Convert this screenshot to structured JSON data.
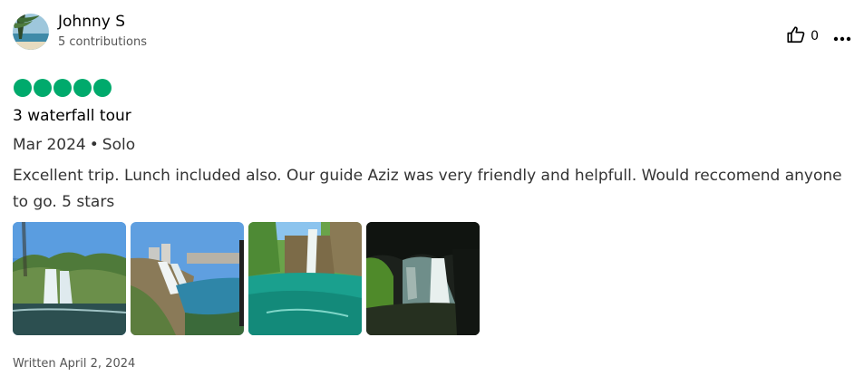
{
  "review": {
    "user": {
      "name": "Johnny S",
      "contributions": "5 contributions"
    },
    "helpful_count": "0",
    "rating": 5,
    "rating_color": "#00AA6C",
    "title": "3 waterfall tour",
    "date": "Mar 2024",
    "trip_type": "Solo",
    "separator": "•",
    "text": "Excellent trip. Lunch included also. Our guide Aziz was very friendly and helpfull. Would reccomend anyone to go. 5 stars",
    "photo_count": 4,
    "written_date": "Written April 2, 2024"
  },
  "icons": {
    "helpful": "thumbs-up-outline-icon",
    "more": "three-dots-horizontal-icon"
  }
}
